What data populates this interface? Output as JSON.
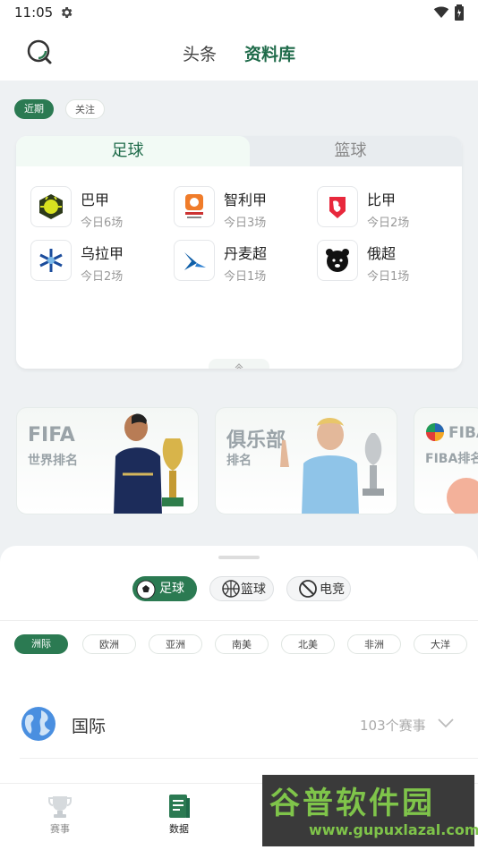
{
  "status_bar": {
    "time": "11:05"
  },
  "header": {
    "tabs": [
      {
        "label": "头条"
      },
      {
        "label": "资料库"
      }
    ]
  },
  "filter_chips": [
    "近期",
    "关注"
  ],
  "sport_card": {
    "tabs": [
      "足球",
      "篮球"
    ],
    "leagues": [
      {
        "name": "巴甲",
        "count": "今日6场"
      },
      {
        "name": "智利甲",
        "count": "今日3场"
      },
      {
        "name": "比甲",
        "count": "今日2场"
      },
      {
        "name": "乌拉甲",
        "count": "今日2场"
      },
      {
        "name": "丹麦超",
        "count": "今日1场"
      },
      {
        "name": "俄超",
        "count": "今日1场"
      }
    ]
  },
  "rankings": [
    {
      "title": "FIFA",
      "sub": "世界排名"
    },
    {
      "title": "俱乐部",
      "sub": "排名"
    },
    {
      "title": "FIBA",
      "sub": "FIBA排名"
    }
  ],
  "sheet": {
    "sports": [
      "足球",
      "篮球",
      "电竞"
    ],
    "regions": [
      "洲际",
      "欧洲",
      "亚洲",
      "南美",
      "北美",
      "非洲",
      "大洋"
    ],
    "row": {
      "label": "国际",
      "count": "103个赛事"
    }
  },
  "nav": [
    {
      "label": "赛事"
    },
    {
      "label": "数据"
    }
  ],
  "watermark": {
    "line1": "谷普软件园",
    "line2": "www.gupuxlazal.com"
  },
  "colors": {
    "accent": "#2b7a52",
    "accent_text": "#1f6b4a"
  }
}
